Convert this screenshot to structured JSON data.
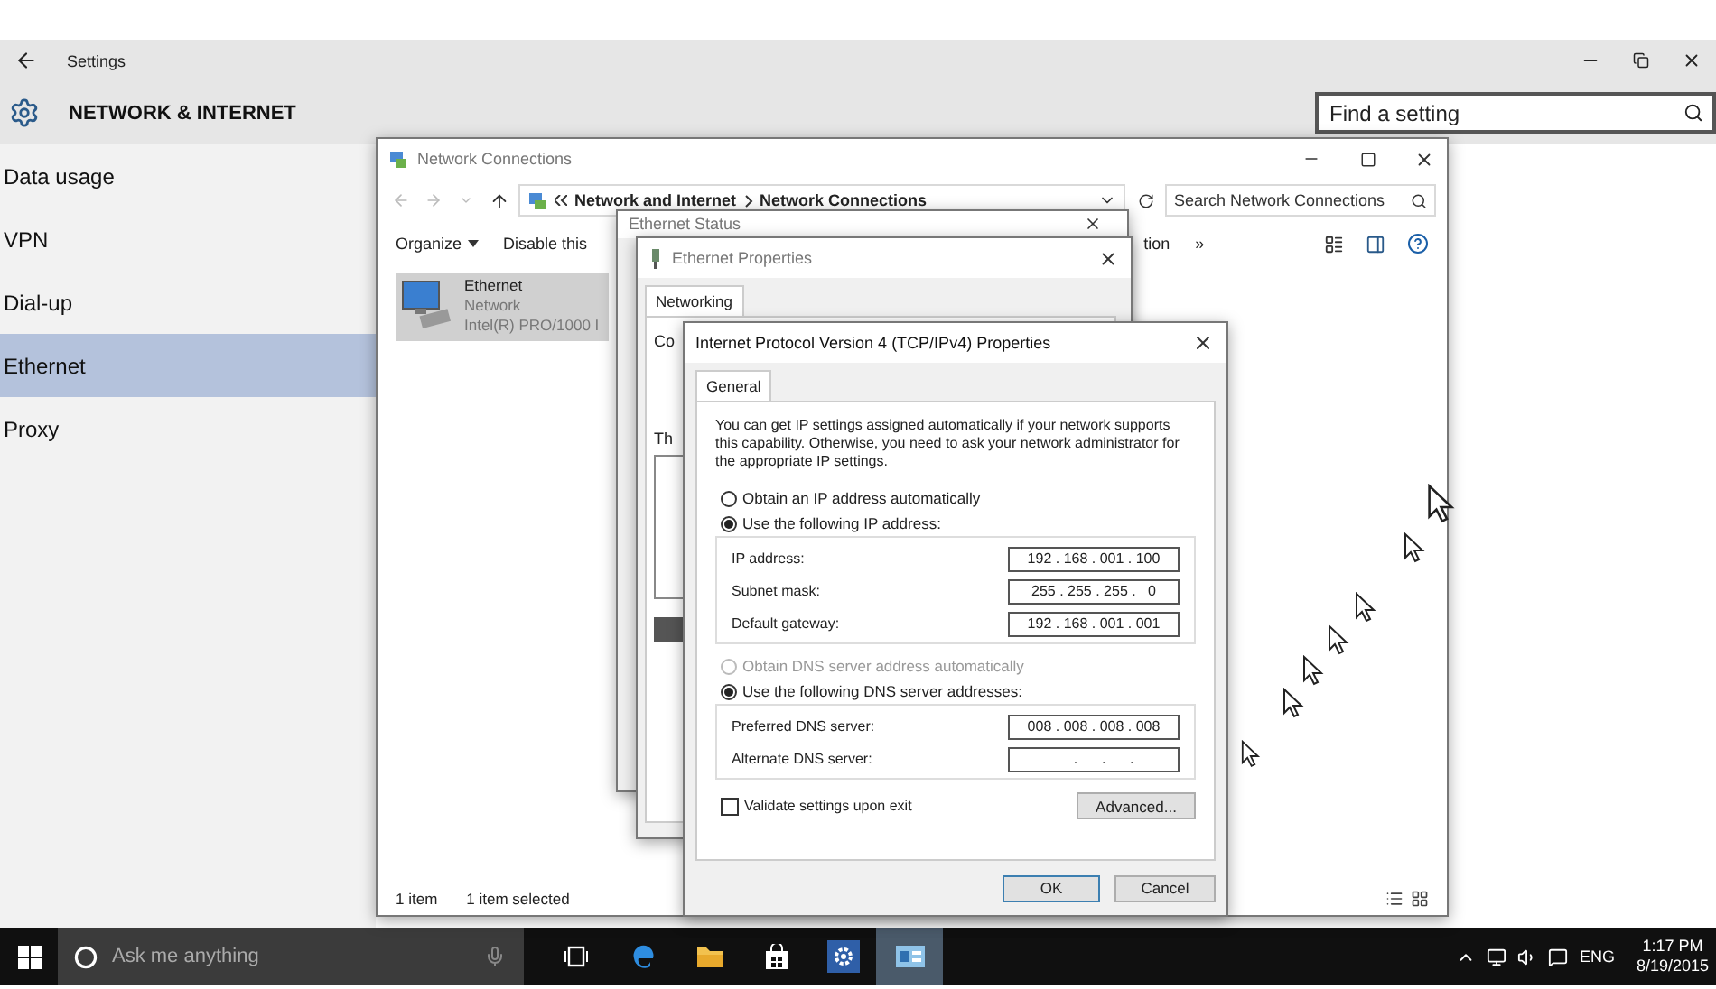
{
  "settings": {
    "title": "Settings",
    "heading": "NETWORK & INTERNET",
    "search": {
      "placeholder": "Find a setting"
    },
    "nav": [
      {
        "label": "Data usage",
        "selected": false
      },
      {
        "label": "VPN",
        "selected": false
      },
      {
        "label": "Dial-up",
        "selected": false
      },
      {
        "label": "Ethernet",
        "selected": true
      },
      {
        "label": "Proxy",
        "selected": false
      }
    ]
  },
  "network_connections": {
    "title": "Network Connections",
    "breadcrumb": [
      "Network and Internet",
      "Network Connections"
    ],
    "search": {
      "placeholder": "Search Network Connections"
    },
    "toolbar": [
      "Organize",
      "Disable this",
      "tion",
      "»"
    ],
    "item": {
      "name": "Ethernet",
      "line_2": "Network",
      "line_3": "Intel(R) PRO/1000 I",
      "selected": true
    },
    "status": [
      "1 item",
      "1 item selected"
    ]
  },
  "ethernet_status": {
    "title": "Ethernet Status"
  },
  "ethernet_properties": {
    "title": "Ethernet Properties",
    "tab": {
      "label": "Networking",
      "selected": true
    },
    "cut_labels": [
      "Co",
      "Th"
    ]
  },
  "ipv4": {
    "title": "Internet Protocol Version 4 (TCP/IPv4) Properties",
    "tab": {
      "label": "General",
      "selected": true
    },
    "intro": "You can get IP settings assigned automatically if your network supports this capability. Otherwise, you need to ask your network administrator for the appropriate IP settings.",
    "ip_options": [
      {
        "label": "Obtain an IP address automatically",
        "selected": false,
        "disabled": false
      },
      {
        "label": "Use the following IP address:",
        "selected": true,
        "disabled": false
      }
    ],
    "ip_fields": [
      {
        "label": "IP address:",
        "value": "192 . 168 . 001 . 100"
      },
      {
        "label": "Subnet mask:",
        "value": "255 . 255 . 255 .   0"
      },
      {
        "label": "Default gateway:",
        "value": "192 . 168 . 001 . 001"
      }
    ],
    "dns_options": [
      {
        "label": "Obtain DNS server address automatically",
        "selected": false,
        "disabled": true
      },
      {
        "label": "Use the following DNS server addresses:",
        "selected": true,
        "disabled": false
      }
    ],
    "dns_fields": [
      {
        "label": "Preferred DNS server:",
        "value": "008 . 008 . 008 . 008"
      },
      {
        "label": "Alternate DNS server:",
        "value": "     .      .      ."
      }
    ],
    "validate": {
      "label": "Validate settings upon exit",
      "checked": false
    },
    "advanced": "Advanced...",
    "buttons": [
      "OK",
      "Cancel"
    ]
  },
  "taskbar": {
    "search": {
      "placeholder": "Ask me anything"
    },
    "apps": [
      {
        "kind": "task-view",
        "active": false
      },
      {
        "kind": "edge",
        "active": false
      },
      {
        "kind": "explorer",
        "active": false
      },
      {
        "kind": "store",
        "active": false
      },
      {
        "kind": "settings",
        "active": false
      },
      {
        "kind": "network",
        "active": true
      }
    ],
    "language": "ENG",
    "time": "1:17 PM",
    "date": "8/19/2015"
  }
}
